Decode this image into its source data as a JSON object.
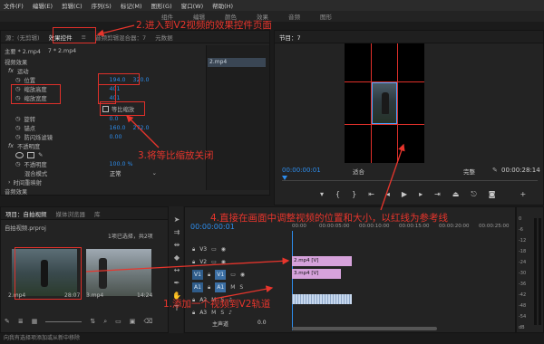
{
  "menu": [
    "文件(F)",
    "编辑(E)",
    "剪辑(C)",
    "序列(S)",
    "标记(M)",
    "图形(G)",
    "窗口(W)",
    "帮助(H)"
  ],
  "workspace_tabs": [
    "组件",
    "编辑",
    "颜色",
    "效果",
    "音频",
    "图形"
  ],
  "left_panel": {
    "tabs": [
      "源：(无剪辑)",
      "效果控件",
      "≡",
      "音频剪辑混合器：7",
      "元数据"
    ],
    "breadcrumb_left": "主要 * 2.mp4",
    "breadcrumb_right": "7 * 2.mp4",
    "section_video": "视频效果",
    "motion": {
      "label": "运动",
      "position_label": "位置",
      "position_x": "194.0",
      "position_y": "320.0",
      "scale_h_label": "缩放高度",
      "scale_h_value": "401",
      "scale_w_label": "缩放宽度",
      "scale_w_value": "401",
      "uniform_label": "等比缩放",
      "rotation_label": "旋转",
      "rotation_value": "0.0",
      "anchor_label": "锚点",
      "anchor_x": "160.0",
      "anchor_y": "272.0",
      "flicker_label": "防闪烁滤镜",
      "flicker_value": "0.00"
    },
    "opacity": {
      "label": "不透明度",
      "opacity_label": "不透明度",
      "opacity_value": "100.0 %",
      "blend_label": "混合模式",
      "blend_value": "正常"
    },
    "time_remap": "时间重映射",
    "section_audio": "音频效果",
    "timecode": "00:00:00:01",
    "clip_label": "2.mp4"
  },
  "program": {
    "tab": "节目：7",
    "timecode": "00:00:00:01",
    "fit": "适合",
    "quality": "完整",
    "duration": "00:00:28:14"
  },
  "project": {
    "tabs": [
      "项目：自拍视频",
      "媒体浏览器",
      "库"
    ],
    "file": "自拍视频.prproj",
    "count": "1项已选择，共2项",
    "items": [
      {
        "name": "2.mp4",
        "duration": "28:07"
      },
      {
        "name": "3.mp4",
        "duration": "14:24"
      }
    ],
    "status": "向我有选择项添加或从新中移除"
  },
  "timeline": {
    "timecode": "00:00:00:01",
    "ruler": [
      "00:00",
      "00:00:05:00",
      "00:00:10:00",
      "00:00:15:00",
      "00:00:20:00",
      "00:00:25:00"
    ],
    "tracks": [
      "V3",
      "V2",
      "V1",
      "A1",
      "A2",
      "A3"
    ],
    "master": "主声道",
    "master_value": "0.0",
    "clips": [
      "2.mp4 [V]",
      "3.mp4 [V]"
    ],
    "db_scale": [
      "0",
      "-6",
      "-12",
      "-18",
      "-24",
      "-30",
      "-36",
      "-42",
      "-48",
      "-54",
      "dB"
    ]
  },
  "annotations": {
    "a1": "1.添加一个视频到V2轨道",
    "a2": "2.进入到V2视频的效果控件页面",
    "a3": "3.将等比缩放关闭",
    "a4": "4.直接在画面中调整视频的位置和大小，以红线为参考线"
  },
  "colors": {
    "annotation": "#e8352c",
    "timecode": "#2d8ceb",
    "video_clip": "#d6a2db",
    "audio_clip": "#c7d8ee"
  }
}
